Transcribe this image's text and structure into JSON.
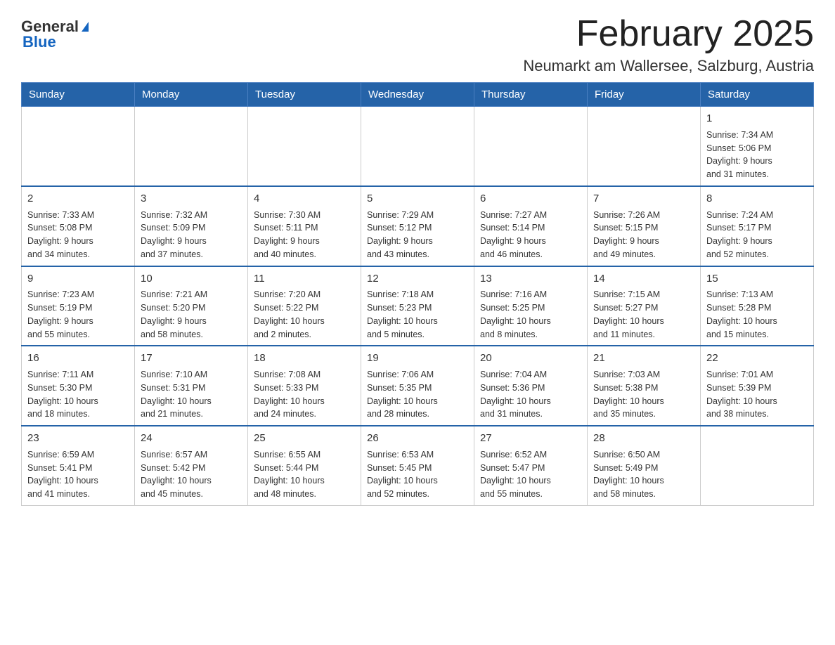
{
  "header": {
    "logo_general": "General",
    "logo_blue": "Blue",
    "month_title": "February 2025",
    "location": "Neumarkt am Wallersee, Salzburg, Austria"
  },
  "days_of_week": [
    "Sunday",
    "Monday",
    "Tuesday",
    "Wednesday",
    "Thursday",
    "Friday",
    "Saturday"
  ],
  "weeks": [
    [
      {
        "day": "",
        "info": ""
      },
      {
        "day": "",
        "info": ""
      },
      {
        "day": "",
        "info": ""
      },
      {
        "day": "",
        "info": ""
      },
      {
        "day": "",
        "info": ""
      },
      {
        "day": "",
        "info": ""
      },
      {
        "day": "1",
        "info": "Sunrise: 7:34 AM\nSunset: 5:06 PM\nDaylight: 9 hours\nand 31 minutes."
      }
    ],
    [
      {
        "day": "2",
        "info": "Sunrise: 7:33 AM\nSunset: 5:08 PM\nDaylight: 9 hours\nand 34 minutes."
      },
      {
        "day": "3",
        "info": "Sunrise: 7:32 AM\nSunset: 5:09 PM\nDaylight: 9 hours\nand 37 minutes."
      },
      {
        "day": "4",
        "info": "Sunrise: 7:30 AM\nSunset: 5:11 PM\nDaylight: 9 hours\nand 40 minutes."
      },
      {
        "day": "5",
        "info": "Sunrise: 7:29 AM\nSunset: 5:12 PM\nDaylight: 9 hours\nand 43 minutes."
      },
      {
        "day": "6",
        "info": "Sunrise: 7:27 AM\nSunset: 5:14 PM\nDaylight: 9 hours\nand 46 minutes."
      },
      {
        "day": "7",
        "info": "Sunrise: 7:26 AM\nSunset: 5:15 PM\nDaylight: 9 hours\nand 49 minutes."
      },
      {
        "day": "8",
        "info": "Sunrise: 7:24 AM\nSunset: 5:17 PM\nDaylight: 9 hours\nand 52 minutes."
      }
    ],
    [
      {
        "day": "9",
        "info": "Sunrise: 7:23 AM\nSunset: 5:19 PM\nDaylight: 9 hours\nand 55 minutes."
      },
      {
        "day": "10",
        "info": "Sunrise: 7:21 AM\nSunset: 5:20 PM\nDaylight: 9 hours\nand 58 minutes."
      },
      {
        "day": "11",
        "info": "Sunrise: 7:20 AM\nSunset: 5:22 PM\nDaylight: 10 hours\nand 2 minutes."
      },
      {
        "day": "12",
        "info": "Sunrise: 7:18 AM\nSunset: 5:23 PM\nDaylight: 10 hours\nand 5 minutes."
      },
      {
        "day": "13",
        "info": "Sunrise: 7:16 AM\nSunset: 5:25 PM\nDaylight: 10 hours\nand 8 minutes."
      },
      {
        "day": "14",
        "info": "Sunrise: 7:15 AM\nSunset: 5:27 PM\nDaylight: 10 hours\nand 11 minutes."
      },
      {
        "day": "15",
        "info": "Sunrise: 7:13 AM\nSunset: 5:28 PM\nDaylight: 10 hours\nand 15 minutes."
      }
    ],
    [
      {
        "day": "16",
        "info": "Sunrise: 7:11 AM\nSunset: 5:30 PM\nDaylight: 10 hours\nand 18 minutes."
      },
      {
        "day": "17",
        "info": "Sunrise: 7:10 AM\nSunset: 5:31 PM\nDaylight: 10 hours\nand 21 minutes."
      },
      {
        "day": "18",
        "info": "Sunrise: 7:08 AM\nSunset: 5:33 PM\nDaylight: 10 hours\nand 24 minutes."
      },
      {
        "day": "19",
        "info": "Sunrise: 7:06 AM\nSunset: 5:35 PM\nDaylight: 10 hours\nand 28 minutes."
      },
      {
        "day": "20",
        "info": "Sunrise: 7:04 AM\nSunset: 5:36 PM\nDaylight: 10 hours\nand 31 minutes."
      },
      {
        "day": "21",
        "info": "Sunrise: 7:03 AM\nSunset: 5:38 PM\nDaylight: 10 hours\nand 35 minutes."
      },
      {
        "day": "22",
        "info": "Sunrise: 7:01 AM\nSunset: 5:39 PM\nDaylight: 10 hours\nand 38 minutes."
      }
    ],
    [
      {
        "day": "23",
        "info": "Sunrise: 6:59 AM\nSunset: 5:41 PM\nDaylight: 10 hours\nand 41 minutes."
      },
      {
        "day": "24",
        "info": "Sunrise: 6:57 AM\nSunset: 5:42 PM\nDaylight: 10 hours\nand 45 minutes."
      },
      {
        "day": "25",
        "info": "Sunrise: 6:55 AM\nSunset: 5:44 PM\nDaylight: 10 hours\nand 48 minutes."
      },
      {
        "day": "26",
        "info": "Sunrise: 6:53 AM\nSunset: 5:45 PM\nDaylight: 10 hours\nand 52 minutes."
      },
      {
        "day": "27",
        "info": "Sunrise: 6:52 AM\nSunset: 5:47 PM\nDaylight: 10 hours\nand 55 minutes."
      },
      {
        "day": "28",
        "info": "Sunrise: 6:50 AM\nSunset: 5:49 PM\nDaylight: 10 hours\nand 58 minutes."
      },
      {
        "day": "",
        "info": ""
      }
    ]
  ]
}
